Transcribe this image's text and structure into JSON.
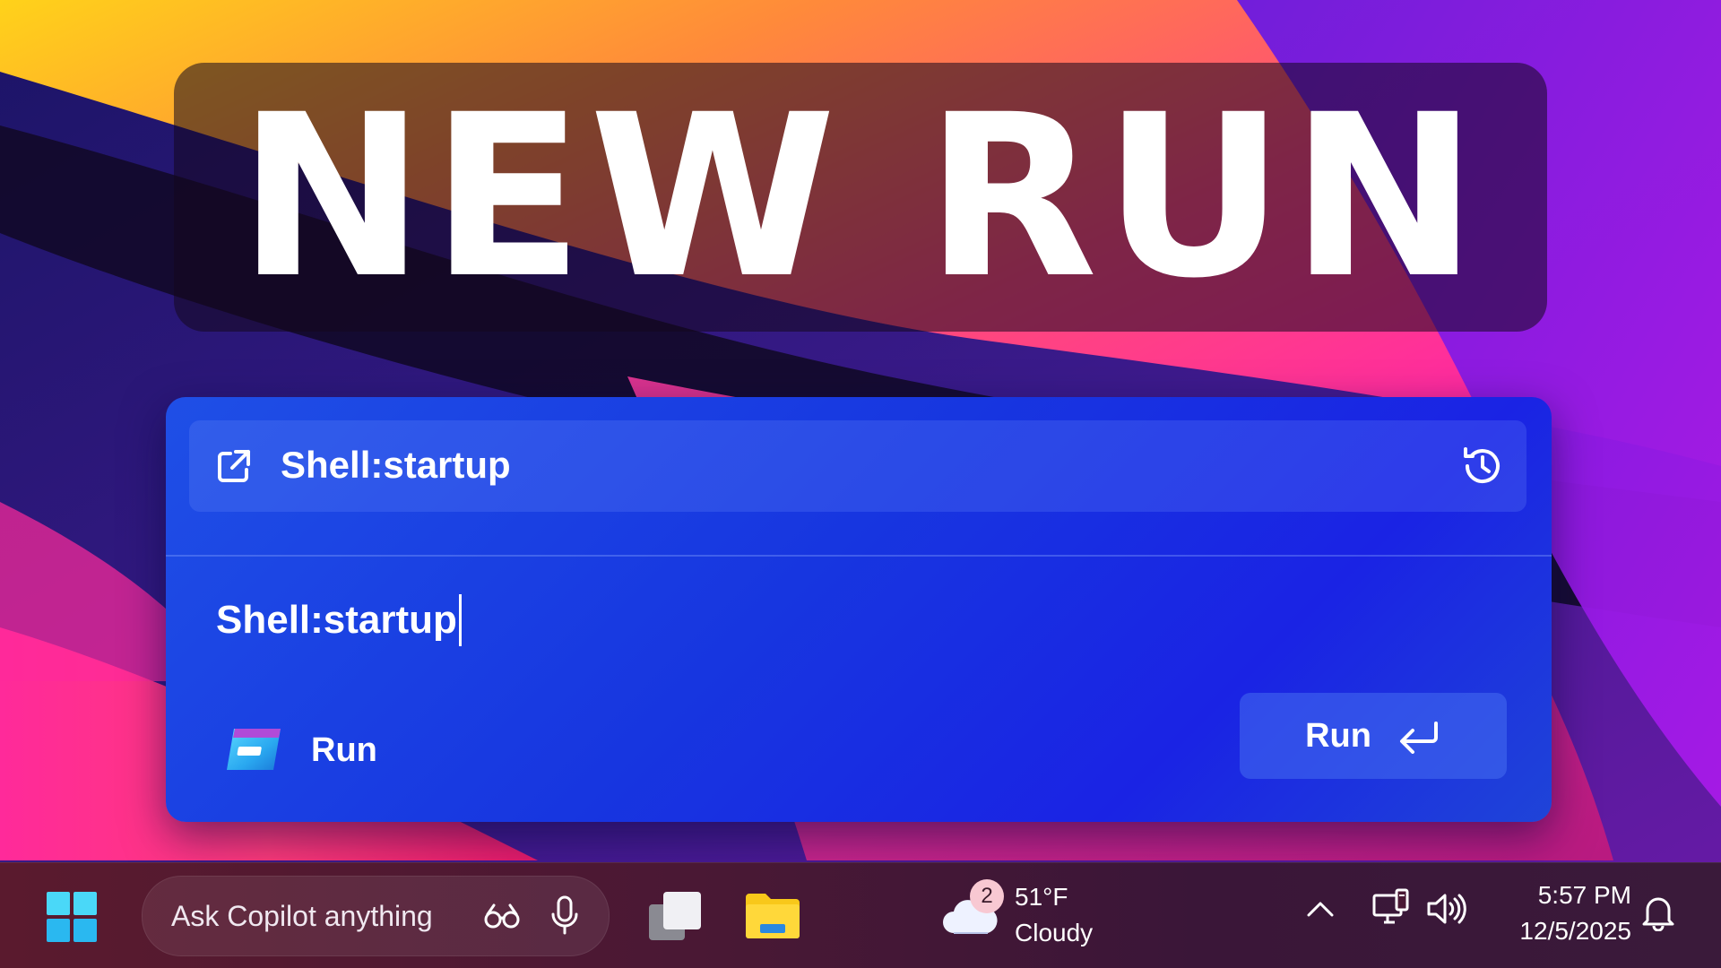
{
  "banner": {
    "title": "NEW RUN"
  },
  "run_dialog": {
    "history_item": "Shell:startup",
    "input_value": "Shell:startup",
    "app_name": "Run",
    "run_button_label": "Run",
    "icons": {
      "open": "open-external-icon",
      "history": "history-clock-icon",
      "app": "run-app-icon",
      "enter": "enter-return-icon"
    }
  },
  "taskbar": {
    "copilot_placeholder": "Ask Copilot anything",
    "weather": {
      "badge": "2",
      "temperature": "51°F",
      "condition": "Cloudy"
    },
    "clock": {
      "time": "5:57 PM",
      "date": "12/5/2025"
    },
    "icons": {
      "start": "windows-start-icon",
      "glasses": "glasses-icon",
      "mic": "microphone-icon",
      "task_view": "task-view-icon",
      "file_explorer": "folder-icon",
      "weather": "cloud-icon",
      "chevron": "chevron-up-icon",
      "network": "network-icon",
      "volume": "volume-icon",
      "bell": "notification-bell-icon"
    }
  },
  "colors": {
    "dialog_accent": "#1a35e0",
    "taskbar_bg": "#4a1834",
    "banner_text": "#ffffff"
  }
}
